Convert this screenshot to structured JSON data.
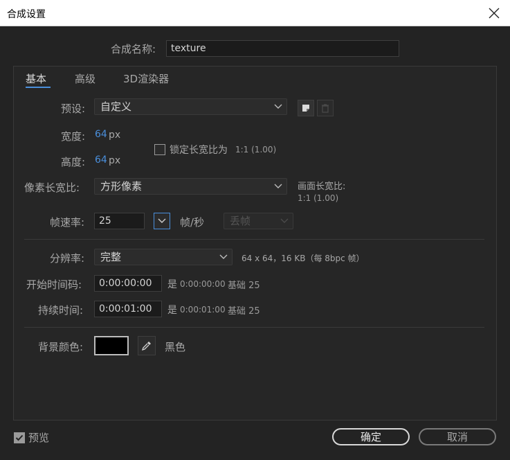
{
  "window": {
    "title": "合成设置"
  },
  "comp_name": {
    "label": "合成名称:",
    "value": "texture"
  },
  "tabs": [
    {
      "label": "基本",
      "active": true
    },
    {
      "label": "高级",
      "active": false
    },
    {
      "label": "3D渲染器",
      "active": false
    }
  ],
  "preset": {
    "label": "预设:",
    "value": "自定义"
  },
  "width": {
    "label": "宽度:",
    "value": "64",
    "unit": "px"
  },
  "height": {
    "label": "高度:",
    "value": "64",
    "unit": "px"
  },
  "lock_aspect": {
    "label": "锁定长宽比为",
    "ratio": "1:1 (1.00)",
    "checked": false
  },
  "pixel_aspect": {
    "label": "像素长宽比:",
    "value": "方形像素"
  },
  "frame_aspect": {
    "label": "画面长宽比:",
    "value": "1:1 (1.00)"
  },
  "frame_rate": {
    "label": "帧速率:",
    "value": "25",
    "unit": "帧/秒",
    "drop_frame": "丢帧"
  },
  "resolution": {
    "label": "分辨率:",
    "value": "完整",
    "info": "64 x 64，16 KB（每 8bpc 帧）"
  },
  "start_timecode": {
    "label": "开始时间码:",
    "value": "0:00:00:00",
    "is_label": "是",
    "is_value": "0:00:00:00",
    "base": "基础 25"
  },
  "duration": {
    "label": "持续时间:",
    "value": "0:00:01:00",
    "is_label": "是",
    "is_value": "0:00:01:00",
    "base": "基础 25"
  },
  "background": {
    "label": "背景颜色:",
    "color": "#000000",
    "color_name": "黑色"
  },
  "preview": {
    "label": "预览",
    "checked": true
  },
  "buttons": {
    "ok": "确定",
    "cancel": "取消"
  },
  "colors": {
    "accent": "#4a8fdc",
    "panel_bg": "#232323",
    "titlebar_bg": "#ffffff"
  }
}
